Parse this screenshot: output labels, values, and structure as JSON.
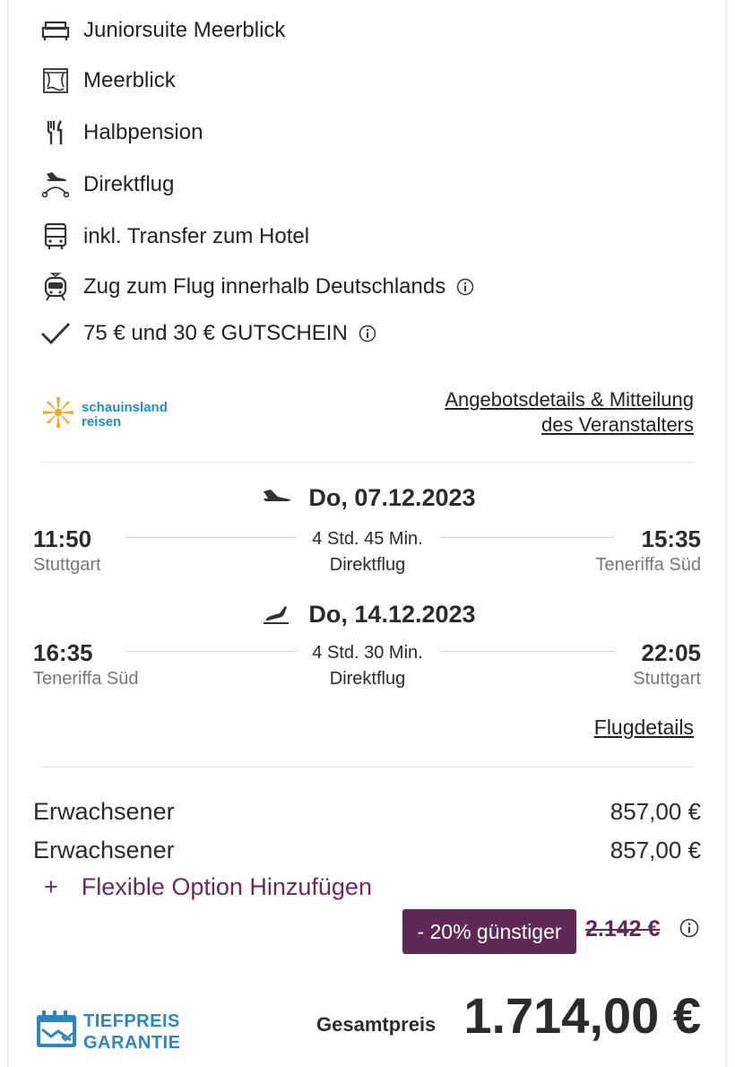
{
  "features": [
    {
      "icon": "bed-icon",
      "label": "Juniorsuite Meerblick"
    },
    {
      "icon": "sea-view-icon",
      "label": "Meerblick"
    },
    {
      "icon": "cutlery-icon",
      "label": "Halbpension"
    },
    {
      "icon": "direct-flight-icon",
      "label": "Direktflug"
    },
    {
      "icon": "bus-icon",
      "label": "inkl. Transfer zum Hotel"
    },
    {
      "icon": "train-icon",
      "label": "Zug zum Flug innerhalb Deutschlands",
      "info": true
    },
    {
      "icon": "checkmark-icon",
      "label": "75 € und 30 € GUTSCHEIN",
      "info": true
    }
  ],
  "operator": {
    "logo_line1": "schauinsland",
    "logo_line2": "reisen",
    "link_line1": "Angebotsdetails & Mitteilung",
    "link_line2": "des Veranstalters",
    "logo_color": "#f5a623",
    "link_color": "#222222"
  },
  "outbound": {
    "date": "Do, 07.12.2023",
    "dep_time": "11:50",
    "dep_city": "Stuttgart",
    "duration": "4 Std. 45 Min.",
    "type": "Direktflug",
    "arr_time": "15:35",
    "arr_city": "Teneriffa Süd"
  },
  "return": {
    "date": "Do, 14.12.2023",
    "dep_time": "16:35",
    "dep_city": "Teneriffa Süd",
    "duration": "4 Std. 30 Min.",
    "type": "Direktflug",
    "arr_time": "22:05",
    "arr_city": "Stuttgart"
  },
  "flight_details_link": "Flugdetails",
  "prices": [
    {
      "label": "Erwachsener",
      "value": "857,00 €"
    },
    {
      "label": "Erwachsener",
      "value": "857,00 €"
    }
  ],
  "flex_option": {
    "plus": "+",
    "label": "Flexible Option Hinzufügen"
  },
  "discount": {
    "badge": "- 20% günstiger",
    "old_price": "2.142 €"
  },
  "guarantee": {
    "line1": "TIEFPREIS",
    "line2": "GARANTIE"
  },
  "total": {
    "label": "Gesamtpreis",
    "value": "1.714,00 €"
  },
  "colors": {
    "accent": "#5e2a55",
    "guarantee": "#2e86c0",
    "text": "#2b2b2b"
  }
}
